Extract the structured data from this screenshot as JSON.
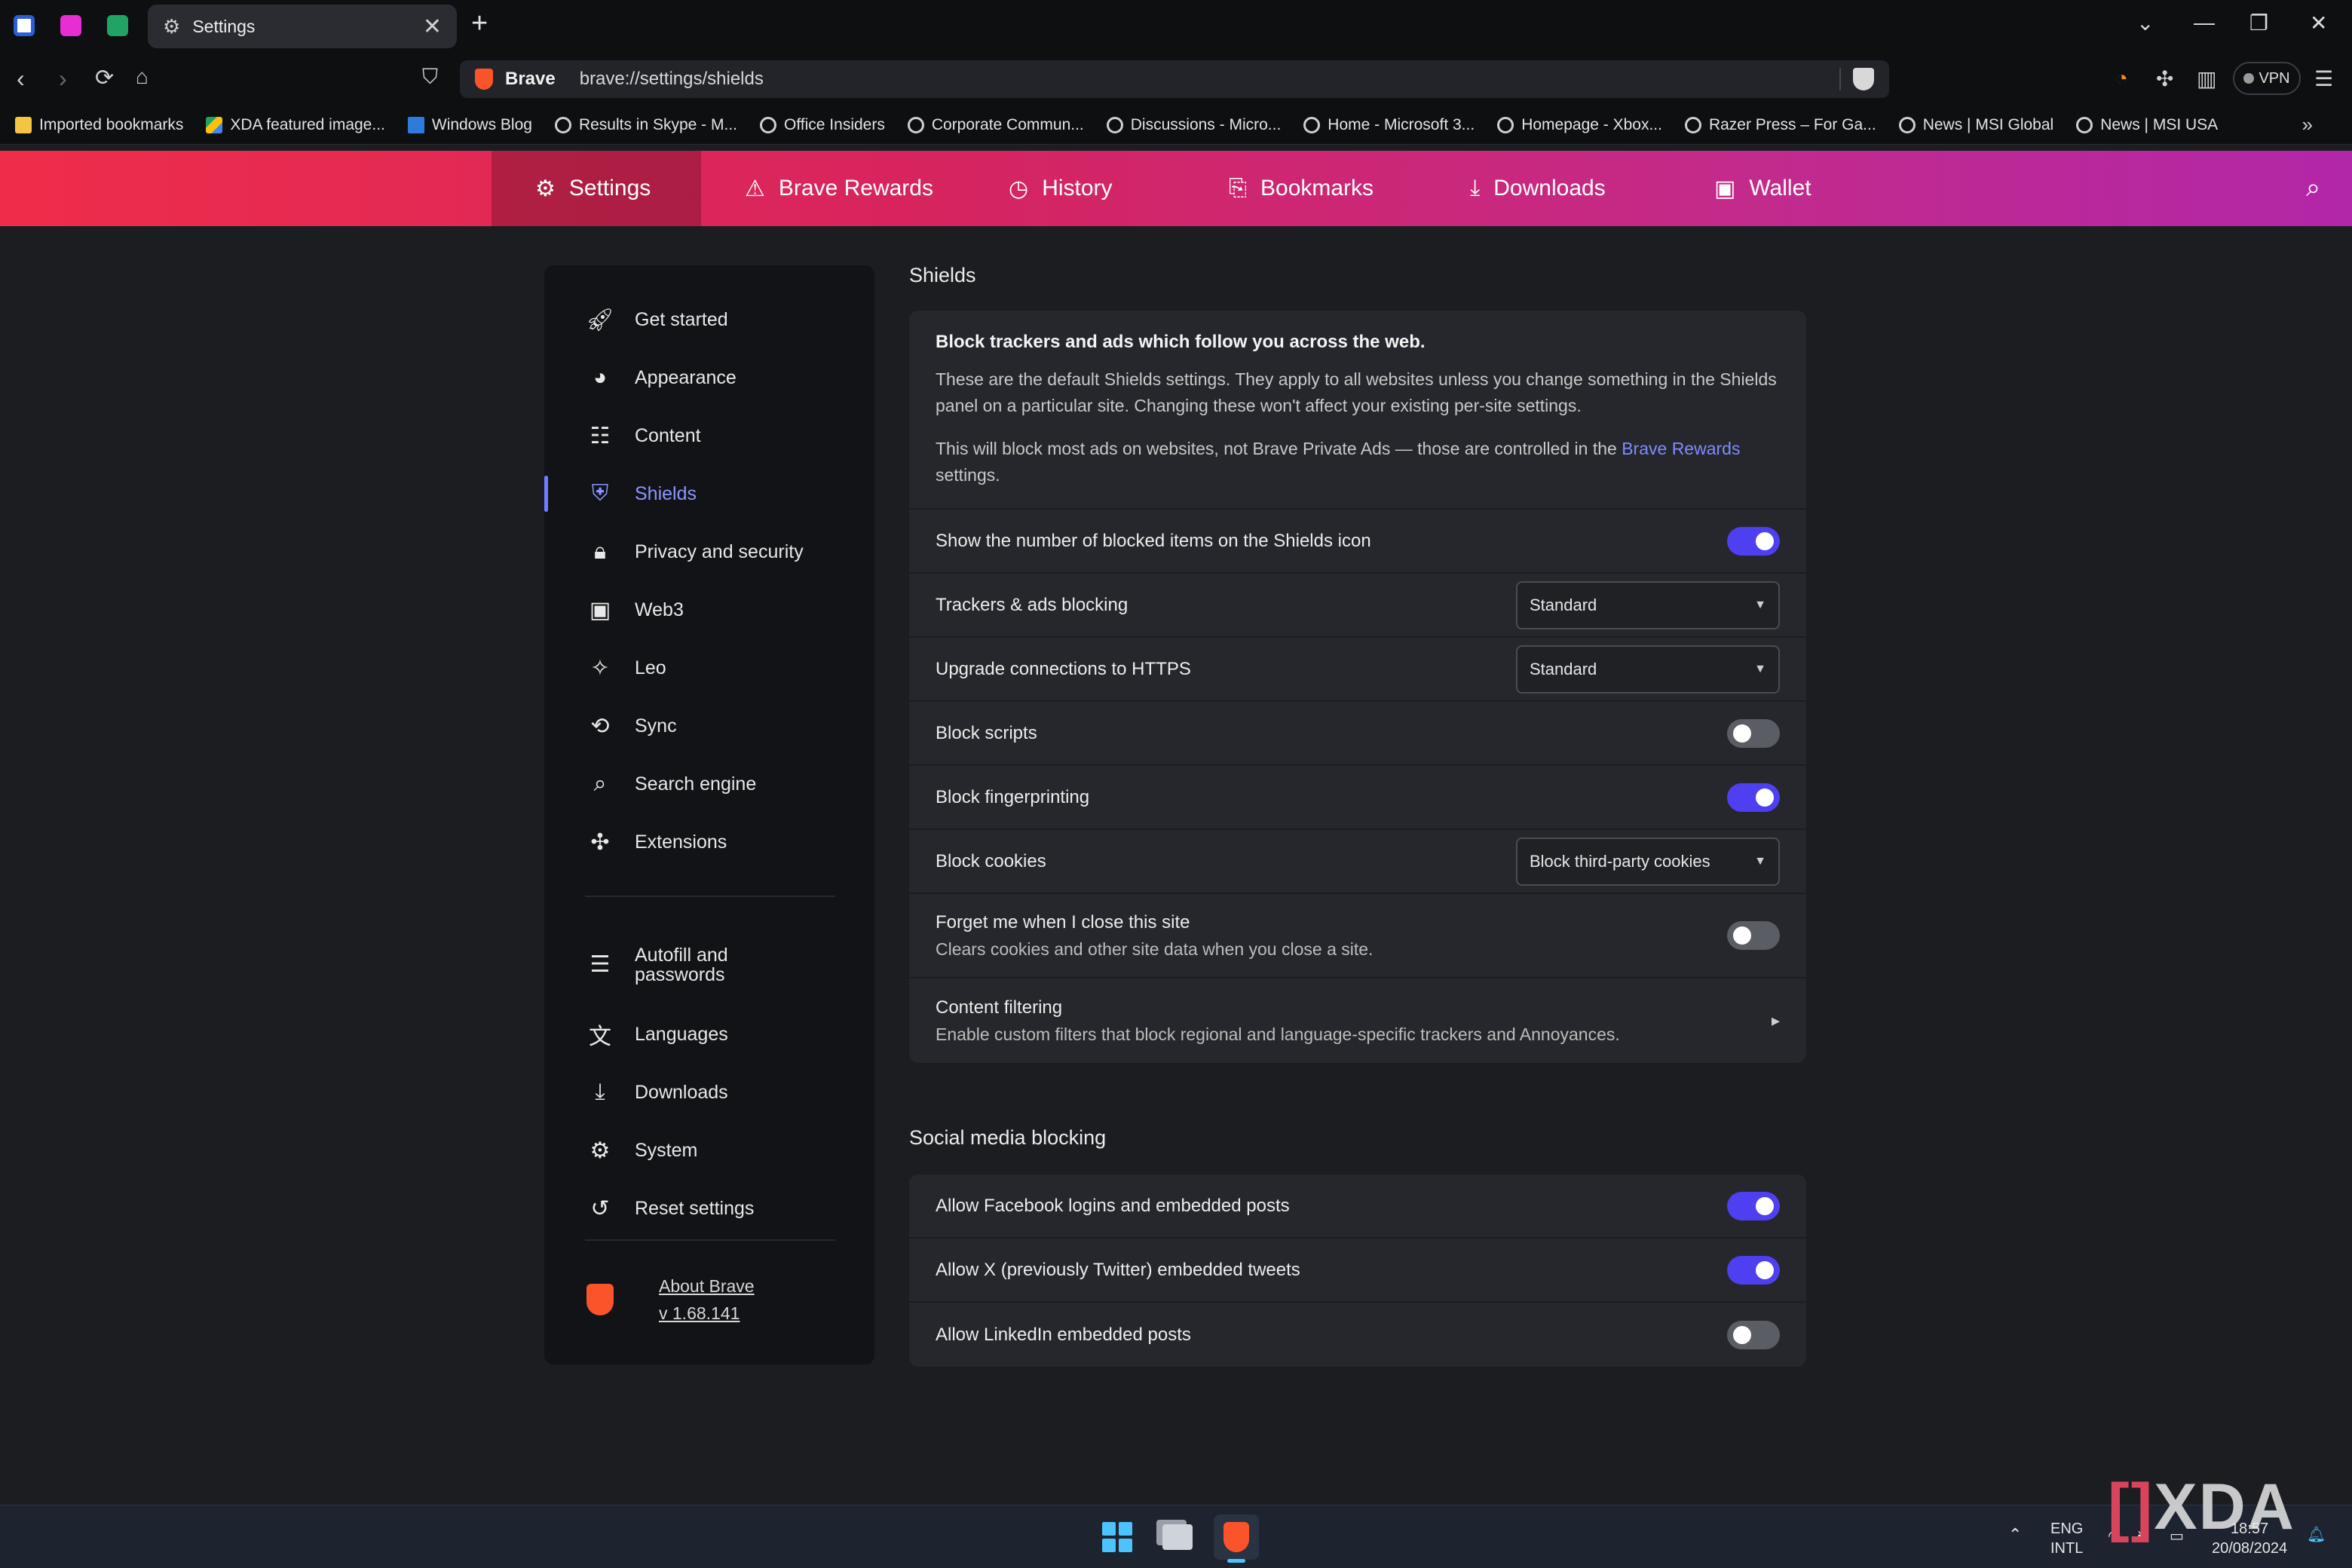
{
  "browser": {
    "tab_title": "Settings",
    "new_tab": "+",
    "close": "✕",
    "brand": "Brave",
    "url": "brave://settings/shields",
    "vpn": "VPN"
  },
  "bookmarks": [
    {
      "label": "Imported bookmarks",
      "icon": "folder"
    },
    {
      "label": "XDA featured image...",
      "icon": "drive"
    },
    {
      "label": "Windows Blog",
      "icon": "win"
    },
    {
      "label": "Results in Skype - M...",
      "icon": "globe"
    },
    {
      "label": "Office Insiders",
      "icon": "globe"
    },
    {
      "label": "Corporate Commun...",
      "icon": "globe"
    },
    {
      "label": "Discussions - Micro...",
      "icon": "globe"
    },
    {
      "label": "Home - Microsoft 3...",
      "icon": "globe"
    },
    {
      "label": "Homepage - Xbox...",
      "icon": "globe"
    },
    {
      "label": "Razer Press – For Ga...",
      "icon": "globe"
    },
    {
      "label": "News | MSI Global",
      "icon": "globe"
    },
    {
      "label": "News | MSI USA",
      "icon": "globe"
    }
  ],
  "appbar": {
    "settings": "Settings",
    "rewards": "Brave Rewards",
    "history": "History",
    "bookmarks": "Bookmarks",
    "downloads": "Downloads",
    "wallet": "Wallet"
  },
  "sidebar": {
    "items": [
      "Get started",
      "Appearance",
      "Content",
      "Shields",
      "Privacy and security",
      "Web3",
      "Leo",
      "Sync",
      "Search engine",
      "Extensions",
      "Autofill and passwords",
      "Languages",
      "Downloads",
      "System",
      "Reset settings"
    ],
    "about_label": "About Brave",
    "version": "v 1.68.141"
  },
  "shields": {
    "section_title": "Shields",
    "heading": "Block trackers and ads which follow you across the web.",
    "para1": "These are the default Shields settings. They apply to all websites unless you change something in the Shields panel on a particular site. Changing these won't affect your existing per-site settings.",
    "para2_pre": "This will block most ads on websites, not Brave Private Ads — those are controlled in the ",
    "para2_link": "Brave Rewards",
    "para2_post": " settings.",
    "rows": {
      "show_count": "Show the number of blocked items on the Shields icon",
      "trackers": "Trackers & ads blocking",
      "trackers_value": "Standard",
      "https": "Upgrade connections to HTTPS",
      "https_value": "Standard",
      "scripts": "Block scripts",
      "fingerprinting": "Block fingerprinting",
      "cookies": "Block cookies",
      "cookies_value": "Block third-party cookies",
      "forget": "Forget me when I close this site",
      "forget_sub": "Clears cookies and other site data when you close a site.",
      "filtering": "Content filtering",
      "filtering_sub": "Enable custom filters that block regional and language-specific trackers and Annoyances."
    }
  },
  "social": {
    "section_title": "Social media blocking",
    "facebook": "Allow Facebook logins and embedded posts",
    "x": "Allow X (previously Twitter) embedded tweets",
    "linkedin": "Allow LinkedIn embedded posts"
  },
  "toggles": {
    "show_count": true,
    "scripts": false,
    "fingerprinting": true,
    "forget": false,
    "facebook": true,
    "x": true,
    "linkedin": false
  },
  "taskbar": {
    "lang1": "ENG",
    "lang2": "INTL",
    "time": "18:57",
    "date": "20/08/2024"
  },
  "watermark": {
    "left": "[",
    "right": "]",
    "text": "XDA"
  },
  "colors": {
    "accent": "#4e3ff0",
    "link": "#7f8cff",
    "header_start": "#ef2d4a",
    "header_end": "#b227a8"
  }
}
